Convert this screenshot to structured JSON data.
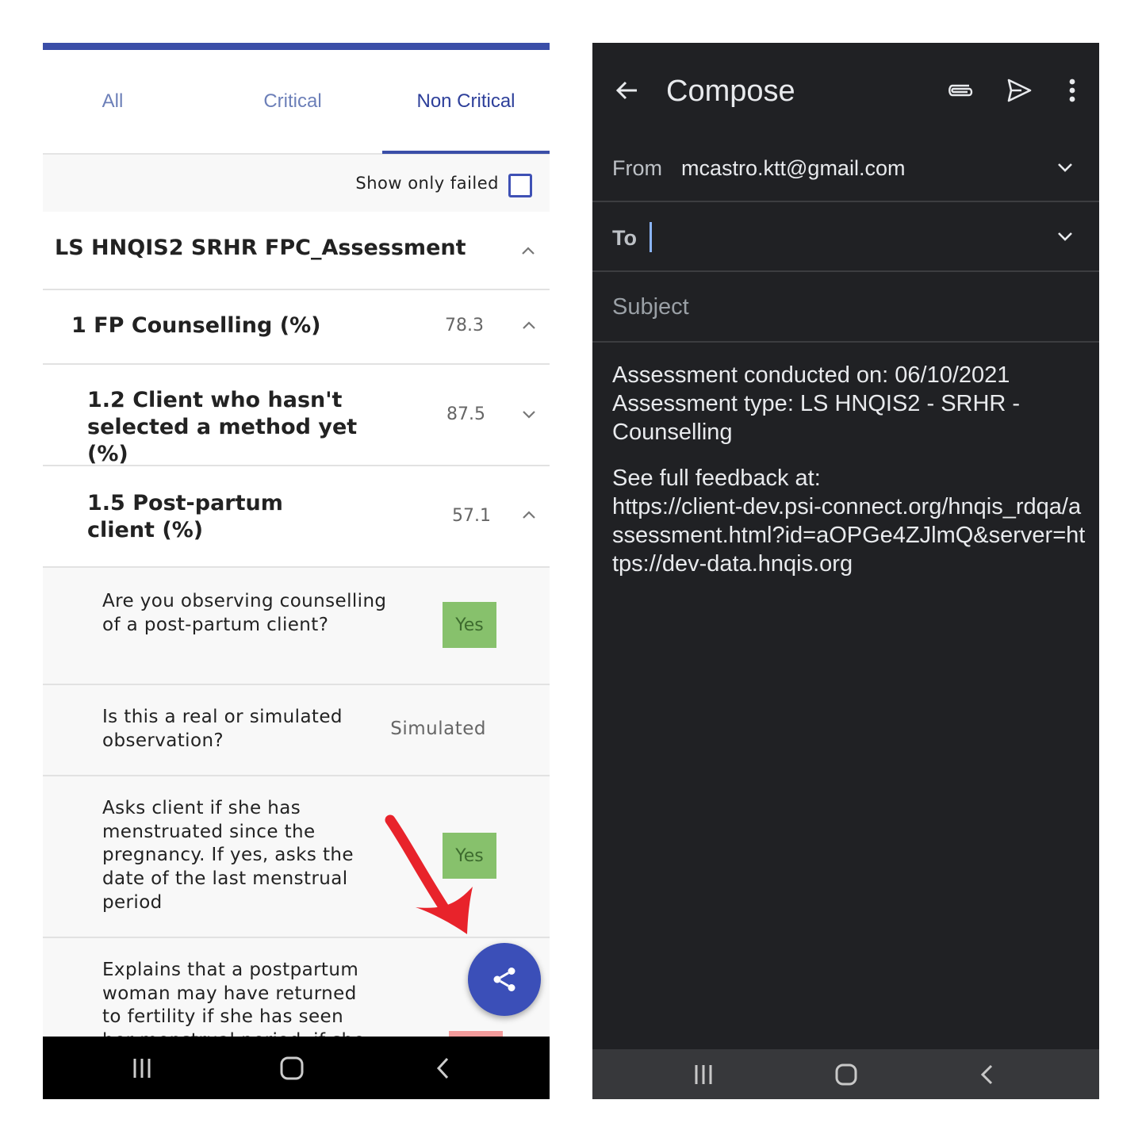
{
  "left": {
    "tabs": [
      {
        "label": "All"
      },
      {
        "label": "Critical"
      },
      {
        "label": "Non Critical",
        "active": true
      }
    ],
    "filter_label": "Show only failed",
    "filter_checked": false,
    "assessment_title": "LS HNQIS2 SRHR FPC_Assessment",
    "sections": [
      {
        "title": "1 FP Counselling (%)",
        "score": "78.3",
        "expanded": true
      },
      {
        "title": "1.2 Client who hasn't selected a method yet (%)",
        "score": "87.5",
        "expanded": false
      },
      {
        "title": "1.5 Post-partum client (%)",
        "score": "57.1",
        "expanded": true
      }
    ],
    "questions": [
      {
        "text": "Are you observing counselling of a post-partum client?",
        "answer": "Yes"
      },
      {
        "text": "Is this a real or simulated observation?",
        "answer": "Simulated"
      },
      {
        "text": "Asks client if she has menstruated since the pregnancy. If yes, asks the date of the last menstrual period",
        "answer": "Yes"
      },
      {
        "text": "Explains that a postpartum woman may have returned to fertility if she has seen her menstrual period, if she is not breastfeeding, or if",
        "answer": "No"
      }
    ],
    "colors": {
      "accent": "#3a4ea8",
      "yes": "#87c16c",
      "no": "#f29a9a",
      "annotation_arrow": "#e8232b"
    },
    "icons": {
      "fab": "share-icon",
      "nav": [
        "recent-apps-icon",
        "home-icon",
        "back-icon"
      ]
    }
  },
  "right": {
    "title": "Compose",
    "from_label": "From",
    "from_value": "mcastro.ktt@gmail.com",
    "to_label": "To",
    "subject_placeholder": "Subject",
    "body_lines": [
      "Assessment conducted on: 06/10/2021",
      "Assessment type: LS HNQIS2 - SRHR - Counselling",
      "See full feedback at:",
      "https://client-dev.psi-connect.org/hnqis_rdqa/assessment.html?id=aOPGe4ZJlmQ&server=https://dev-data.hnqis.org"
    ],
    "icons": [
      "back-arrow-icon",
      "attach-icon",
      "send-icon",
      "more-vert-icon"
    ],
    "colors": {
      "background": "#202124",
      "caret": "#8ab4f8"
    }
  }
}
